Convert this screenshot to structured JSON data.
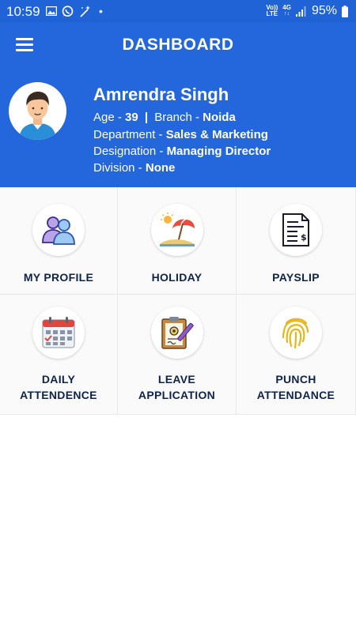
{
  "status_bar": {
    "time": "10:59",
    "net_top": "Vo))",
    "net_bottom": "LTE",
    "net_type": "4G",
    "battery": "95%"
  },
  "app_bar": {
    "title": "DASHBOARD"
  },
  "profile": {
    "name": "Amrendra Singh",
    "age_label": "Age - ",
    "age_value": "39",
    "separator": "|",
    "branch_label": "Branch - ",
    "branch_value": "Noida",
    "department_label": "Department - ",
    "department_value": "Sales & Marketing",
    "designation_label": "Designation - ",
    "designation_value": "Managing Director",
    "division_label": "Division - ",
    "division_value": "None"
  },
  "menu": [
    {
      "line1": "MY PROFILE",
      "line2": "",
      "icon": "users-icon"
    },
    {
      "line1": "HOLIDAY",
      "line2": "",
      "icon": "beach-umbrella-icon"
    },
    {
      "line1": "PAYSLIP",
      "line2": "",
      "icon": "payslip-document-icon"
    },
    {
      "line1": "DAILY",
      "line2": "ATTENDENCE",
      "icon": "calendar-icon"
    },
    {
      "line1": "LEAVE",
      "line2": "APPLICATION",
      "icon": "clipboard-pen-icon"
    },
    {
      "line1": "PUNCH",
      "line2": "ATTENDANCE",
      "icon": "fingerprint-icon"
    }
  ],
  "colors": {
    "primary": "#2466db",
    "status_bar": "#1f63d6",
    "label_text": "#0e2349"
  }
}
